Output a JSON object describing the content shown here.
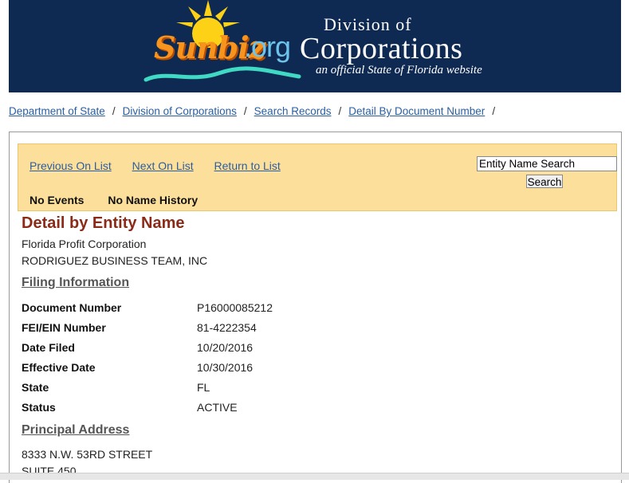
{
  "header": {
    "logo_sunbiz": "Sunbiz",
    "logo_org": ".org",
    "division_of": "Division of",
    "corporations": "Corporations",
    "tagline": "an official State of Florida website",
    "colors": {
      "banner_bg": "#0f2a52",
      "sunbiz_orange": "#f7941d",
      "org_blue": "#6cc3ec"
    }
  },
  "breadcrumb": [
    "Department of State",
    "Division of Corporations",
    "Search Records",
    "Detail By Document Number"
  ],
  "breadcrumb_separator": "/",
  "nav": {
    "previous": "Previous On List",
    "next": "Next On List",
    "return": "Return to List",
    "search_value": "Entity Name Search",
    "search_button": "Search",
    "no_events": "No Events",
    "no_name_history": "No Name History"
  },
  "detail": {
    "title": "Detail by Entity Name",
    "entity_type": "Florida Profit Corporation",
    "entity_name": "RODRIGUEZ BUSINESS TEAM, INC"
  },
  "filing": {
    "heading": "Filing Information",
    "rows": [
      {
        "label": "Document Number",
        "value": "P16000085212"
      },
      {
        "label": "FEI/EIN Number",
        "value": "81-4222354"
      },
      {
        "label": "Date Filed",
        "value": "10/20/2016"
      },
      {
        "label": "Effective Date",
        "value": "10/30/2016"
      },
      {
        "label": "State",
        "value": "FL"
      },
      {
        "label": "Status",
        "value": "ACTIVE"
      }
    ]
  },
  "principal": {
    "heading": "Principal Address",
    "line1": "8333 N.W. 53RD STREET",
    "line2": "SUITE 450"
  }
}
